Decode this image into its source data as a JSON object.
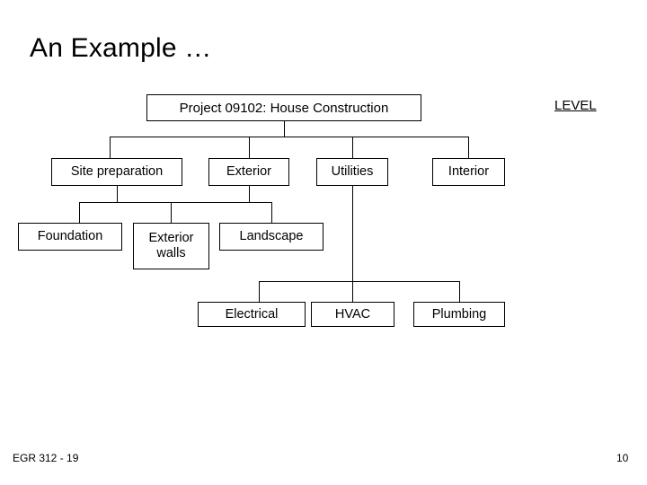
{
  "slide": {
    "title": "An Example …",
    "level_label": "LEVEL",
    "footer_left": "EGR 312 - 19",
    "page_number": "10",
    "background_color": "#ffffff",
    "line_color": "#000000",
    "text_color": "#000000"
  },
  "chart_data": {
    "type": "diagram",
    "diagram_kind": "work-breakdown-structure",
    "title": "An Example …",
    "annotations": [
      "LEVEL"
    ],
    "orientation": "top-down",
    "levels": [
      {
        "level": 1,
        "nodes": [
          {
            "id": "root",
            "label": "Project 09102: House Construction"
          }
        ]
      },
      {
        "level": 2,
        "nodes": [
          {
            "id": "site",
            "label": "Site preparation"
          },
          {
            "id": "exterior",
            "label": "Exterior"
          },
          {
            "id": "utilities",
            "label": "Utilities"
          },
          {
            "id": "interior",
            "label": "Interior"
          }
        ]
      },
      {
        "level": 3,
        "nodes": [
          {
            "id": "foundation",
            "label": "Foundation"
          },
          {
            "id": "extwalls",
            "label": "Exterior\nwalls"
          },
          {
            "id": "landscape",
            "label": "Landscape"
          }
        ]
      },
      {
        "level": 4,
        "nodes": [
          {
            "id": "electrical",
            "label": "Electrical"
          },
          {
            "id": "hvac",
            "label": "HVAC"
          },
          {
            "id": "plumbing",
            "label": "Plumbing"
          }
        ]
      }
    ],
    "edges": [
      {
        "from": "root",
        "to": "site"
      },
      {
        "from": "root",
        "to": "exterior"
      },
      {
        "from": "root",
        "to": "utilities"
      },
      {
        "from": "root",
        "to": "interior"
      },
      {
        "from": "site",
        "to": "foundation"
      },
      {
        "from": "site",
        "to": "extwalls"
      },
      {
        "from": "site",
        "to": "landscape"
      },
      {
        "from": "exterior",
        "to": "extwalls"
      },
      {
        "from": "utilities",
        "to": "electrical"
      },
      {
        "from": "utilities",
        "to": "hvac"
      },
      {
        "from": "utilities",
        "to": "plumbing"
      }
    ]
  },
  "nodes": {
    "root": "Project 09102: House Construction",
    "site": "Site preparation",
    "exterior": "Exterior",
    "utilities": "Utilities",
    "interior": "Interior",
    "foundation": "Foundation",
    "extwalls": "Exterior\nwalls",
    "landscape": "Landscape",
    "electrical": "Electrical",
    "hvac": "HVAC",
    "plumbing": "Plumbing"
  }
}
